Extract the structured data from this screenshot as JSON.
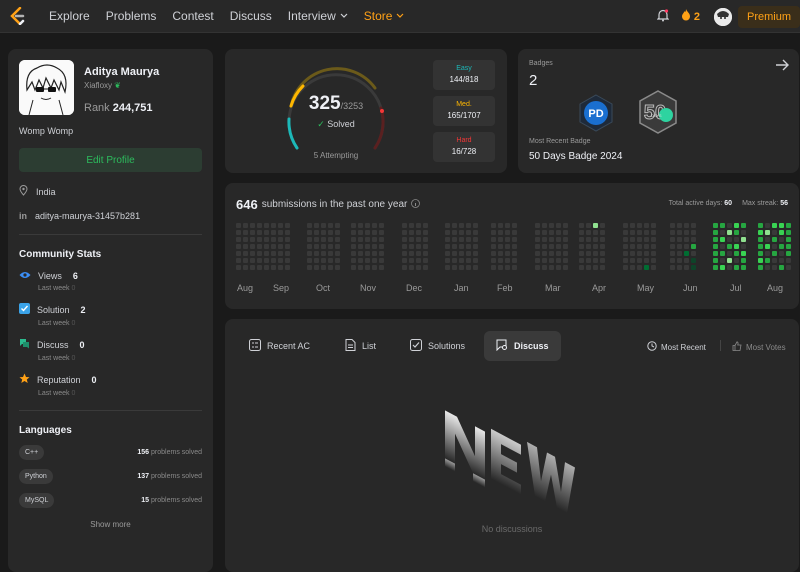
{
  "nav": {
    "items": [
      "Explore",
      "Problems",
      "Contest",
      "Discuss",
      "Interview",
      "Store"
    ],
    "streak_count": "2",
    "premium_label": "Premium"
  },
  "profile": {
    "name": "Aditya Maurya",
    "username": "Xiafloxy",
    "rank_label": "Rank",
    "rank_value": "244,751",
    "bio": "Womp Womp",
    "edit_label": "Edit Profile",
    "location": "India",
    "linkedin": "aditya-maurya-31457b281"
  },
  "community": {
    "title": "Community Stats",
    "stats": [
      {
        "label": "Views",
        "value": "6",
        "sub": "Last week",
        "delta": "0",
        "icon": "eye-icon",
        "color": "#3b8ef5"
      },
      {
        "label": "Solution",
        "value": "2",
        "sub": "Last week",
        "delta": "0",
        "icon": "check-square-icon",
        "color": "#3ba3e8"
      },
      {
        "label": "Discuss",
        "value": "0",
        "sub": "Last week",
        "delta": "0",
        "icon": "chat-bubble-icon",
        "color": "#2cbb8e"
      },
      {
        "label": "Reputation",
        "value": "0",
        "sub": "Last week",
        "delta": "0",
        "icon": "star-icon",
        "color": "#ffa116"
      }
    ]
  },
  "languages": {
    "title": "Languages",
    "items": [
      {
        "name": "C++",
        "count": "156",
        "suffix": "problems solved"
      },
      {
        "name": "Python",
        "count": "137",
        "suffix": "problems solved"
      },
      {
        "name": "MySQL",
        "count": "15",
        "suffix": "problems solved"
      }
    ],
    "show_more": "Show more"
  },
  "solved": {
    "count": "325",
    "total": "/3253",
    "label": "Solved",
    "attempting": "5 Attempting",
    "difficulties": [
      {
        "label": "Easy",
        "value": "144/818",
        "color": "#1cb8b8"
      },
      {
        "label": "Med.",
        "value": "165/1707",
        "color": "#ffb700"
      },
      {
        "label": "Hard",
        "value": "16/728",
        "color": "#f63737"
      }
    ]
  },
  "badges": {
    "title": "Badges",
    "count": "2",
    "recent_label": "Most Recent Badge",
    "recent_name": "50 Days Badge 2024",
    "items": [
      {
        "name": "PD",
        "icon": "pd-badge-icon"
      },
      {
        "name": "50 DAYS",
        "icon": "fifty-days-badge-icon"
      }
    ]
  },
  "submissions": {
    "count": "646",
    "label": "submissions in the past one year",
    "active_days_label": "Total active days:",
    "active_days": "60",
    "max_streak_label": "Max streak:",
    "max_streak": "56",
    "months": [
      "Aug",
      "Sep",
      "Oct",
      "Nov",
      "Dec",
      "Jan",
      "Feb",
      "Mar",
      "Apr",
      "May",
      "Jun",
      "Jul",
      "Aug"
    ],
    "colors": {
      "empty": "#393939",
      "l1": "#0e4429",
      "l2": "#006d32",
      "l3": "#26a641",
      "l4": "#39d353",
      "l5": "#8fe08f"
    }
  },
  "discussion": {
    "tabs": [
      {
        "label": "Recent AC",
        "icon": "list-check-icon"
      },
      {
        "label": "List",
        "icon": "document-icon"
      },
      {
        "label": "Solutions",
        "icon": "check-box-icon"
      },
      {
        "label": "Discuss",
        "icon": "chat-search-icon"
      }
    ],
    "active_tab": "Discuss",
    "sort_recent": "Most Recent",
    "sort_votes": "Most Votes",
    "empty_text": "No discussions"
  }
}
